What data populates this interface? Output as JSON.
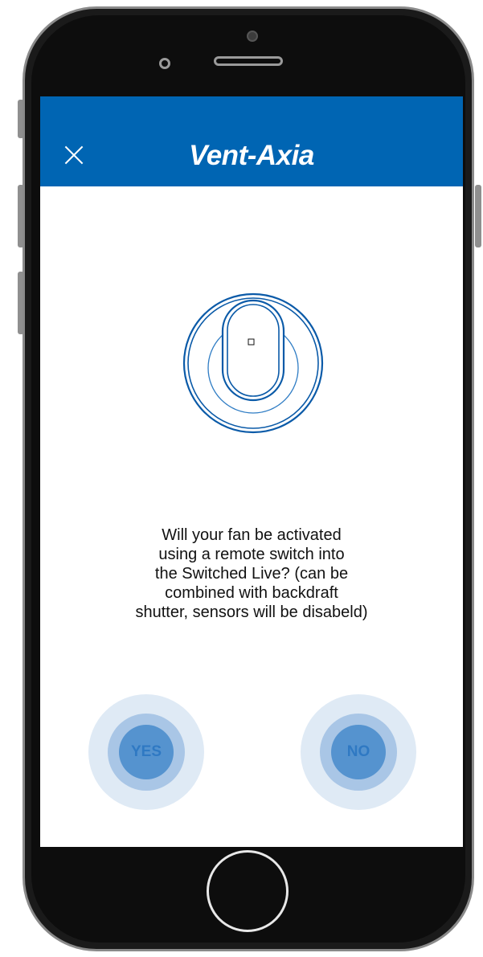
{
  "header": {
    "logo_text": "Vent-Axia",
    "background_color": "#0065b3",
    "close_icon": "close-icon"
  },
  "illustration": {
    "icon": "fan-switch-icon",
    "stroke_color": "#0a5aa8"
  },
  "question": {
    "lines": [
      "Will your fan be activated",
      "using a remote switch into",
      "the Switched Live? (can be",
      "combined with backdraft",
      "shutter, sensors will be disabeld)"
    ]
  },
  "answers": {
    "yes_label": "YES",
    "no_label": "NO",
    "colors": {
      "outer": "#dfeaf5",
      "middle": "#a9c6e6",
      "inner": "#5593cf",
      "text": "#2f79c3"
    }
  }
}
